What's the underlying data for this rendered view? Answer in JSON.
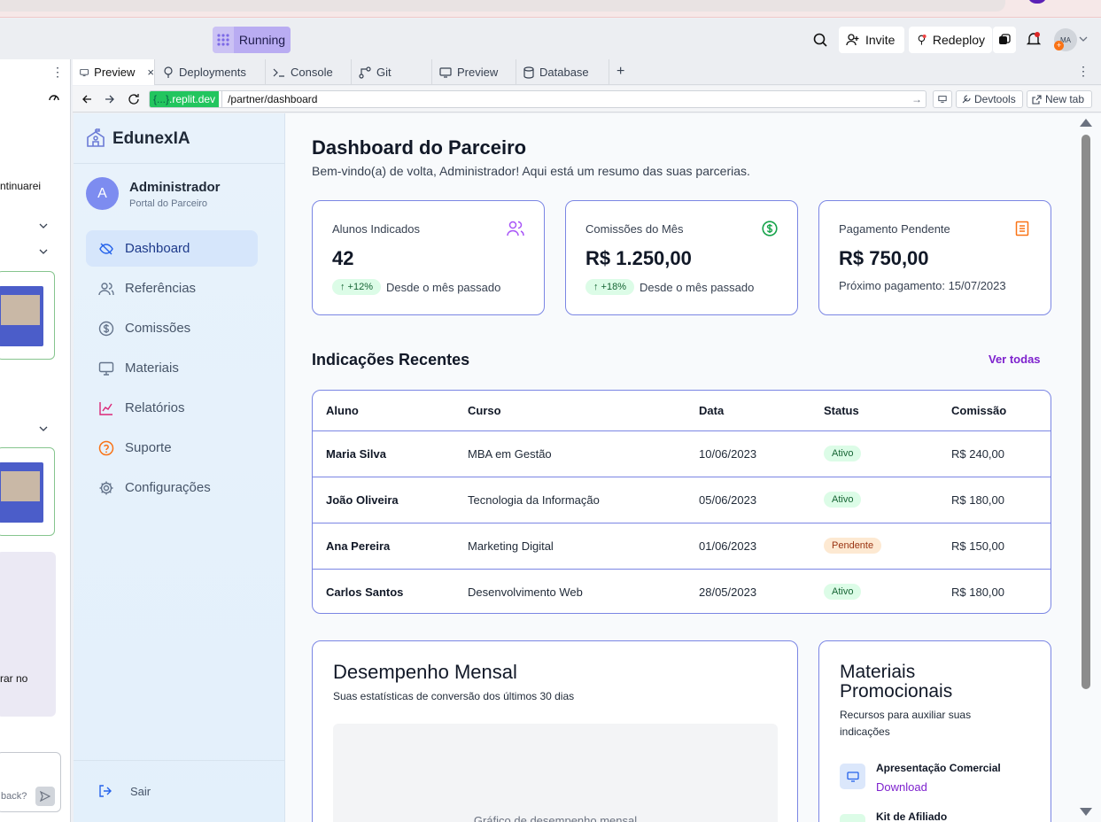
{
  "toolbar": {
    "running_label": "Running",
    "invite_label": "Invite",
    "redeploy_label": "Redeploy",
    "avatar_initials": "MA"
  },
  "tabs": [
    {
      "label": "Preview",
      "icon": "monitor-icon"
    },
    {
      "label": "Deployments",
      "icon": "deploy-icon"
    },
    {
      "label": "Console",
      "icon": "terminal-icon"
    },
    {
      "label": "Git",
      "icon": "git-icon"
    },
    {
      "label": "Preview",
      "icon": "monitor-icon"
    },
    {
      "label": "Database",
      "icon": "database-icon"
    }
  ],
  "address": {
    "domain_prefix": "{...}",
    "domain": ".replit.dev",
    "path": "/partner/dashboard",
    "devtools_label": "Devtools",
    "newtab_label": "New tab"
  },
  "left_pane": {
    "text1": "ntinuarei",
    "text2": "rar no",
    "text3": "back?"
  },
  "sidebar": {
    "brand": "EdunexIA",
    "user_initial": "A",
    "user_name": "Administrador",
    "user_role": "Portal do Parceiro",
    "items": [
      {
        "label": "Dashboard",
        "icon": "eye-off-icon",
        "color": "#2563eb"
      },
      {
        "label": "Referências",
        "icon": "users-icon",
        "color": "#64748b"
      },
      {
        "label": "Comissões",
        "icon": "dollar-icon",
        "color": "#64748b"
      },
      {
        "label": "Materiais",
        "icon": "monitor-icon",
        "color": "#64748b"
      },
      {
        "label": "Relatórios",
        "icon": "chart-line-icon",
        "color": "#db2777"
      },
      {
        "label": "Suporte",
        "icon": "help-circle-icon",
        "color": "#f97316"
      },
      {
        "label": "Configurações",
        "icon": "gear-icon",
        "color": "#64748b"
      }
    ],
    "logout": "Sair"
  },
  "header": {
    "title": "Dashboard do Parceiro",
    "subtitle": "Bem-vindo(a) de volta, Administrador! Aqui está um resumo das suas parcerias."
  },
  "stats": [
    {
      "label": "Alunos Indicados",
      "value": "42",
      "badge": "↑ +12%",
      "note": "Desde o mês passado",
      "icon": "users-icon",
      "accent": "#a855f7"
    },
    {
      "label": "Comissões do Mês",
      "value": "R$ 1.250,00",
      "badge": "↑ +18%",
      "note": "Desde o mês passado",
      "icon": "dollar-icon",
      "accent": "#16a34a"
    },
    {
      "label": "Pagamento Pendente",
      "value": "R$ 750,00",
      "note": "Próximo pagamento: 15/07/2023",
      "icon": "document-icon",
      "accent": "#f97316"
    }
  ],
  "recent": {
    "title": "Indicações Recentes",
    "view_all": "Ver todas",
    "columns": [
      "Aluno",
      "Curso",
      "Data",
      "Status",
      "Comissão"
    ],
    "rows": [
      {
        "aluno": "Maria Silva",
        "curso": "MBA em Gestão",
        "data": "10/06/2023",
        "status": "Ativo",
        "comissao": "R$ 240,00"
      },
      {
        "aluno": "João Oliveira",
        "curso": "Tecnologia da Informação",
        "data": "05/06/2023",
        "status": "Ativo",
        "comissao": "R$ 180,00"
      },
      {
        "aluno": "Ana Pereira",
        "curso": "Marketing Digital",
        "data": "01/06/2023",
        "status": "Pendente",
        "comissao": "R$ 150,00"
      },
      {
        "aluno": "Carlos Santos",
        "curso": "Desenvolvimento Web",
        "data": "28/05/2023",
        "status": "Ativo",
        "comissao": "R$ 180,00"
      }
    ]
  },
  "performance": {
    "title": "Desempenho Mensal",
    "subtitle": "Suas estatísticas de conversão dos últimos 30 dias",
    "placeholder": "Gráfico de desempenho mensal"
  },
  "materials": {
    "title": "Materiais Promocionais",
    "subtitle": "Recursos para auxiliar suas indicações",
    "items": [
      {
        "name": "Apresentação Comercial",
        "action": "Download"
      },
      {
        "name": "Kit de Afiliado"
      }
    ]
  }
}
